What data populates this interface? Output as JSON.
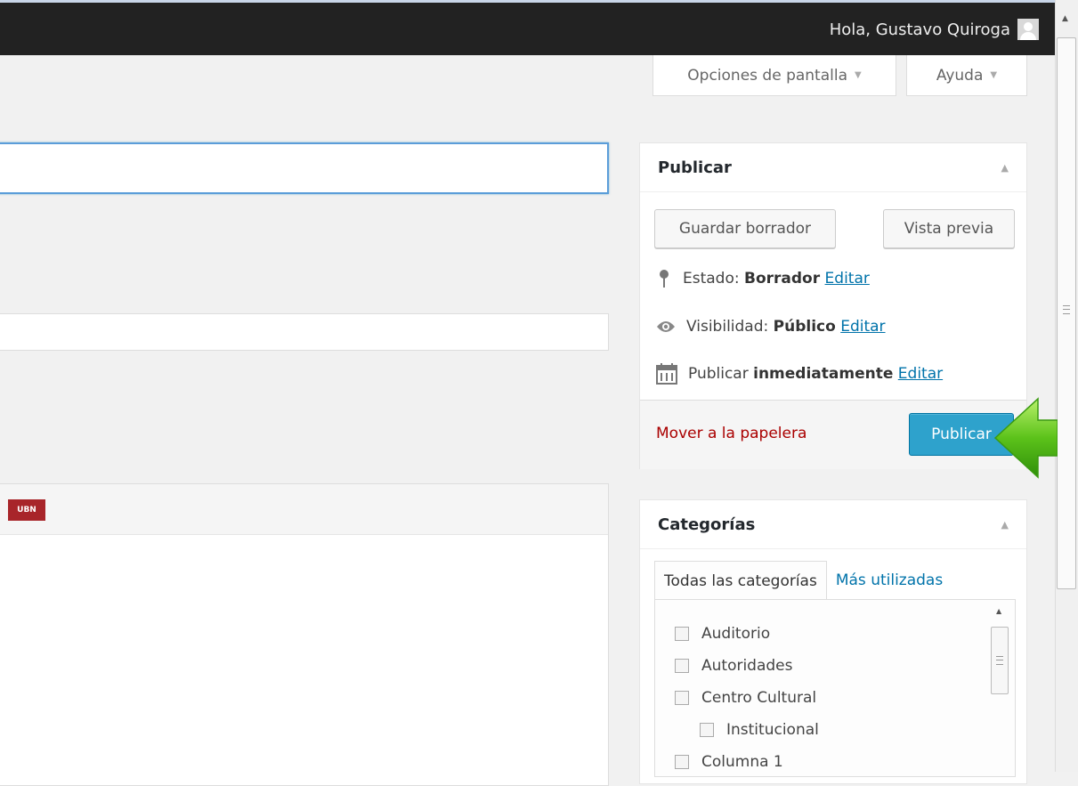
{
  "adminbar": {
    "greeting": "Hola, Gustavo Quiroga"
  },
  "screen_meta": {
    "screen_options": "Opciones de pantalla",
    "help": "Ayuda"
  },
  "publish_box": {
    "title": "Publicar",
    "save_draft": "Guardar borrador",
    "preview": "Vista previa",
    "status_label": "Estado:",
    "status_value": "Borrador",
    "visibility_label": "Visibilidad:",
    "visibility_value": "Público",
    "schedule_label": "Publicar",
    "schedule_value": "inmediatamente",
    "edit_link": "Editar",
    "trash": "Mover a la papelera",
    "publish": "Publicar"
  },
  "editor": {
    "plugin_icon_text": "UBN"
  },
  "categories_box": {
    "title": "Categorías",
    "tab_all": "Todas las categorías",
    "tab_popular": "Más utilizadas",
    "items": [
      {
        "label": "Auditorio",
        "checked": false,
        "child": false
      },
      {
        "label": "Autoridades",
        "checked": false,
        "child": false
      },
      {
        "label": "Centro Cultural",
        "checked": false,
        "child": false
      },
      {
        "label": "Institucional",
        "checked": false,
        "child": true
      },
      {
        "label": "Columna 1",
        "checked": false,
        "child": false
      }
    ]
  },
  "colors": {
    "adminbar": "#222222",
    "publish_button": "#2ea2cc",
    "link": "#0073aa",
    "trash_link": "#aa0000",
    "arrow": "#5cc21a"
  },
  "icons": [
    "user-avatar-icon",
    "pin-icon",
    "eye-icon",
    "calendar-icon",
    "green-arrow-icon",
    "caret-down-icon",
    "collapse-arrow-icon"
  ]
}
